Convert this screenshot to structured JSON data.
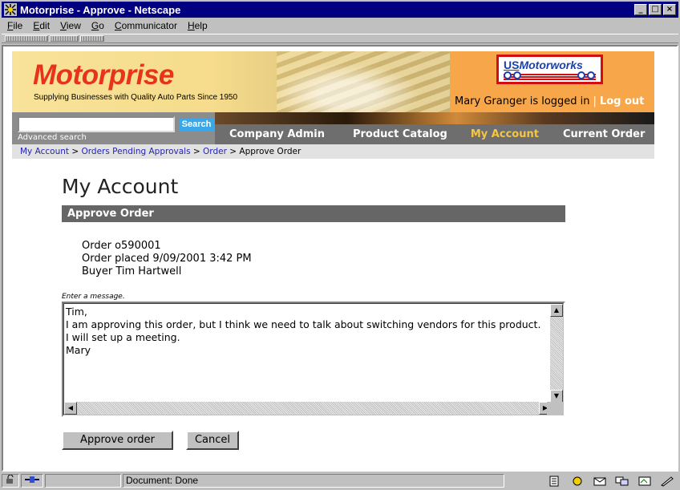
{
  "window": {
    "title": "Motorprise - Approve - Netscape"
  },
  "menu": [
    "File",
    "Edit",
    "View",
    "Go",
    "Communicator",
    "Help"
  ],
  "header": {
    "logo": "Motorprise",
    "tagline": "Supplying Businesses with Quality Auto Parts Since 1950",
    "partner_logo_us": "US",
    "partner_logo_rest": "Motorworks",
    "logged_in_text": "Mary Granger is logged in",
    "separator": "|",
    "logout": "Log out"
  },
  "search": {
    "value": "",
    "button": "Search",
    "advanced": "Advanced search"
  },
  "nav": {
    "tabs": [
      "Company Admin",
      "Product Catalog",
      "My Account",
      "Current Order"
    ],
    "active": "My Account"
  },
  "breadcrumb": {
    "items": [
      "My Account",
      "Orders Pending Approvals",
      "Order"
    ],
    "sep": ">",
    "current": "Approve Order"
  },
  "page": {
    "title": "My Account",
    "section": "Approve Order",
    "order_line": "Order o590001",
    "placed_line": "Order placed 9/09/2001 3:42 PM",
    "buyer_line": "Buyer Tim Hartwell",
    "message_label": "Enter a message.",
    "message": "Tim,\nI am approving this order, but I think we need to talk about switching vendors for this product.\nI will set up a meeting.\nMary",
    "approve_button": "Approve order",
    "cancel_button": "Cancel"
  },
  "status": {
    "text": "Document: Done"
  },
  "colors": {
    "title_bar": "#000080",
    "logo_red": "#e8331a",
    "header_orange": "#f7a74a",
    "nav_gray": "#6e6e6e",
    "nav_active": "#f6c544",
    "search_blue": "#3aa8e8",
    "link_blue": "#2323b4"
  }
}
